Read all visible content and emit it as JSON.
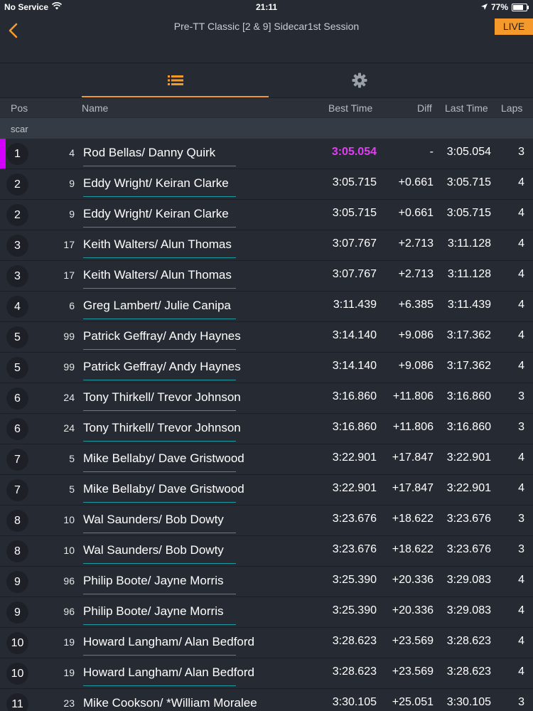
{
  "status_bar": {
    "carrier": "No Service",
    "time": "21:11",
    "battery": "77%",
    "battery_level": 0.77
  },
  "nav": {
    "title": "Pre-TT Classic [2 & 9] Sidecar1st Session",
    "live_label": "LIVE"
  },
  "tabs": {
    "list_icon": "list-icon",
    "settings_icon": "gear-icon"
  },
  "columns": {
    "pos": "Pos",
    "name": "Name",
    "best": "Best Time",
    "diff": "Diff",
    "last": "Last Time",
    "laps": "Laps"
  },
  "section": {
    "label": "scar"
  },
  "colors": {
    "accent": "#f59a2a",
    "leader": "#d400ff",
    "fastest": "#e23cf5",
    "name_underline": "#1e9aa3"
  },
  "rows": [
    {
      "pos": "1",
      "num": "4",
      "name": "Rod Bellas/ Danny Quirk",
      "best": "3:05.054",
      "diff": "-",
      "last": "3:05.054",
      "laps": "3",
      "leader": true
    },
    {
      "pos": "2",
      "num": "9",
      "name": "Eddy Wright/ Keiran Clarke",
      "best": "3:05.715",
      "diff": "+0.661",
      "last": "3:05.715",
      "laps": "4"
    },
    {
      "pos": "2",
      "num": "9",
      "name": "Eddy Wright/ Keiran Clarke",
      "best": "3:05.715",
      "diff": "+0.661",
      "last": "3:05.715",
      "laps": "4"
    },
    {
      "pos": "3",
      "num": "17",
      "name": "Keith Walters/ Alun  Thomas",
      "best": "3:07.767",
      "diff": "+2.713",
      "last": "3:11.128",
      "laps": "4"
    },
    {
      "pos": "3",
      "num": "17",
      "name": "Keith Walters/ Alun  Thomas",
      "best": "3:07.767",
      "diff": "+2.713",
      "last": "3:11.128",
      "laps": "4"
    },
    {
      "pos": "4",
      "num": "6",
      "name": "Greg Lambert/ Julie Canipa",
      "best": "3:11.439",
      "diff": "+6.385",
      "last": "3:11.439",
      "laps": "4"
    },
    {
      "pos": "5",
      "num": "99",
      "name": "Patrick Geffray/ Andy Haynes",
      "best": "3:14.140",
      "diff": "+9.086",
      "last": "3:17.362",
      "laps": "4"
    },
    {
      "pos": "5",
      "num": "99",
      "name": "Patrick Geffray/ Andy Haynes",
      "best": "3:14.140",
      "diff": "+9.086",
      "last": "3:17.362",
      "laps": "4"
    },
    {
      "pos": "6",
      "num": "24",
      "name": "Tony Thirkell/ Trevor  Johnson",
      "best": "3:16.860",
      "diff": "+11.806",
      "last": "3:16.860",
      "laps": "3"
    },
    {
      "pos": "6",
      "num": "24",
      "name": "Tony Thirkell/ Trevor  Johnson",
      "best": "3:16.860",
      "diff": "+11.806",
      "last": "3:16.860",
      "laps": "3"
    },
    {
      "pos": "7",
      "num": "5",
      "name": "Mike Bellaby/ Dave Gristwood",
      "best": "3:22.901",
      "diff": "+17.847",
      "last": "3:22.901",
      "laps": "4"
    },
    {
      "pos": "7",
      "num": "5",
      "name": "Mike Bellaby/ Dave Gristwood",
      "best": "3:22.901",
      "diff": "+17.847",
      "last": "3:22.901",
      "laps": "4"
    },
    {
      "pos": "8",
      "num": "10",
      "name": "Wal Saunders/ Bob Dowty",
      "best": "3:23.676",
      "diff": "+18.622",
      "last": "3:23.676",
      "laps": "3"
    },
    {
      "pos": "8",
      "num": "10",
      "name": "Wal Saunders/ Bob Dowty",
      "best": "3:23.676",
      "diff": "+18.622",
      "last": "3:23.676",
      "laps": "3"
    },
    {
      "pos": "9",
      "num": "96",
      "name": "Philip Boote/ Jayne Morris",
      "best": "3:25.390",
      "diff": "+20.336",
      "last": "3:29.083",
      "laps": "4"
    },
    {
      "pos": "9",
      "num": "96",
      "name": "Philip Boote/ Jayne Morris",
      "best": "3:25.390",
      "diff": "+20.336",
      "last": "3:29.083",
      "laps": "4"
    },
    {
      "pos": "10",
      "num": "19",
      "name": "Howard Langham/ Alan Bedford",
      "best": "3:28.623",
      "diff": "+23.569",
      "last": "3:28.623",
      "laps": "4"
    },
    {
      "pos": "10",
      "num": "19",
      "name": "Howard Langham/ Alan Bedford",
      "best": "3:28.623",
      "diff": "+23.569",
      "last": "3:28.623",
      "laps": "4"
    },
    {
      "pos": "11",
      "num": "23",
      "name": "Mike Cookson/ *William Moralee",
      "best": "3:30.105",
      "diff": "+25.051",
      "last": "3:30.105",
      "laps": "3"
    }
  ]
}
